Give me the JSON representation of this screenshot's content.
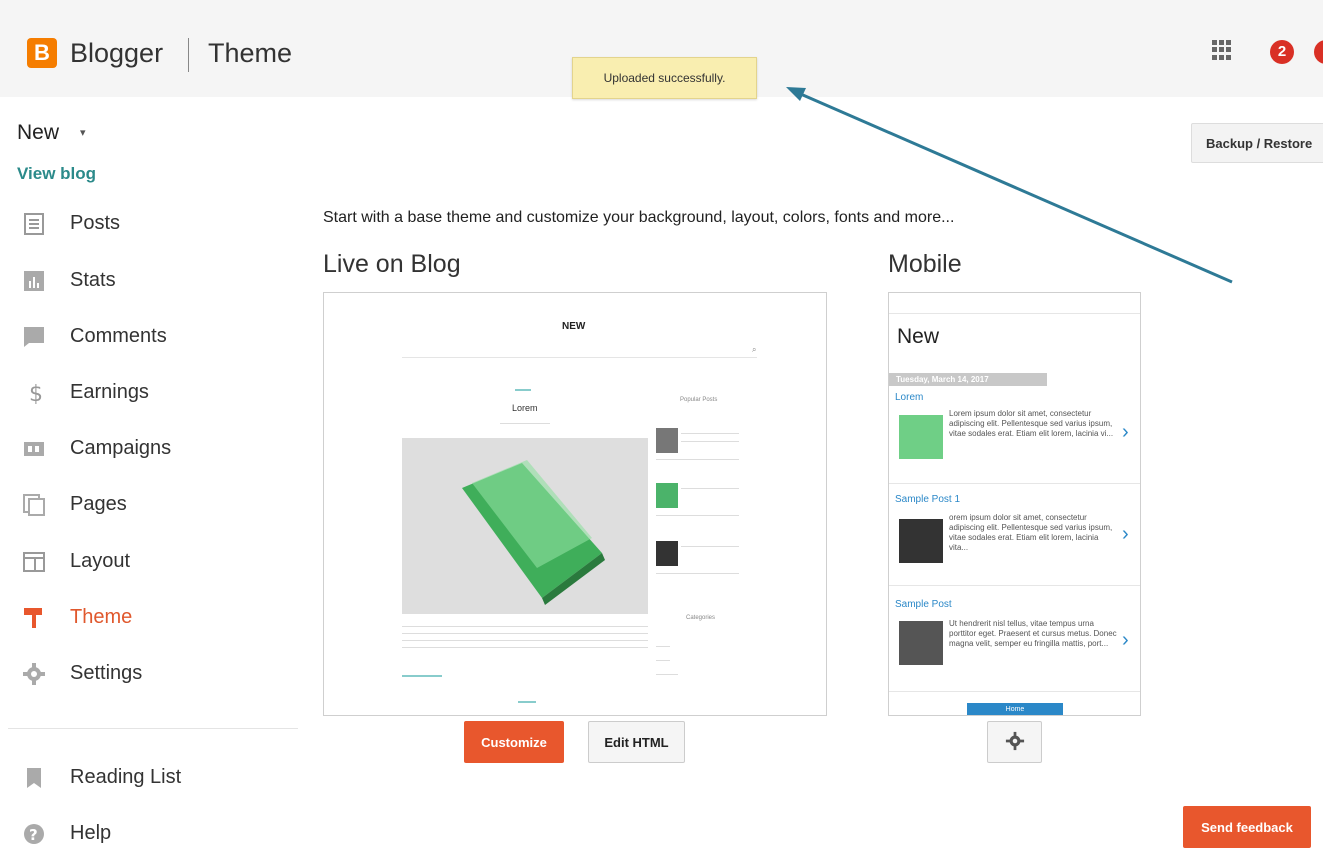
{
  "header": {
    "logo_letter": "B",
    "brand": "Blogger",
    "section": "Theme",
    "notification_count": "2",
    "icons": [
      "apps-grid-icon",
      "notifications-icon",
      "account-avatar-icon"
    ]
  },
  "toast": {
    "message": "Uploaded successfully."
  },
  "sidebar": {
    "blog_name": "New",
    "view_blog": "View blog",
    "items": [
      {
        "label": "Posts",
        "icon": "posts-icon"
      },
      {
        "label": "Stats",
        "icon": "stats-icon"
      },
      {
        "label": "Comments",
        "icon": "comments-icon"
      },
      {
        "label": "Earnings",
        "icon": "earnings-icon"
      },
      {
        "label": "Campaigns",
        "icon": "campaigns-icon"
      },
      {
        "label": "Pages",
        "icon": "pages-icon"
      },
      {
        "label": "Layout",
        "icon": "layout-icon"
      },
      {
        "label": "Theme",
        "icon": "theme-icon",
        "active": true
      },
      {
        "label": "Settings",
        "icon": "settings-icon"
      }
    ],
    "secondary": [
      {
        "label": "Reading List",
        "icon": "bookmark-icon"
      },
      {
        "label": "Help",
        "icon": "help-icon"
      }
    ]
  },
  "main": {
    "intro": "Start with a base theme and customize your background, layout, colors, fonts and more...",
    "live_heading": "Live on Blog",
    "mobile_heading": "Mobile",
    "backup_button": "Backup / Restore",
    "customize_button": "Customize",
    "edit_html_button": "Edit HTML",
    "feedback_button": "Send feedback"
  },
  "live_preview": {
    "blog_title": "NEW",
    "post_title": "Lorem",
    "sidebar_heading": "Popular Posts",
    "categories_heading": "Categories"
  },
  "mobile_preview": {
    "blog_title": "New",
    "date": "Tuesday, March 14, 2017",
    "posts": [
      {
        "title": "Lorem",
        "excerpt": "Lorem ipsum dolor sit amet, consectetur adipiscing elit. Pellentesque sed varius ipsum, vitae sodales erat. Etiam elit lorem, lacinia vi..."
      },
      {
        "title": "Sample Post 1",
        "excerpt": "orem ipsum dolor sit amet, consectetur adipiscing elit. Pellentesque sed varius ipsum, vitae sodales erat. Etiam elit lorem, lacinia vita..."
      },
      {
        "title": "Sample Post",
        "excerpt": "Ut hendrerit nisl tellus, vitae tempus urna porttitor eget. Praesent et cursus metus. Donec magna velit, semper eu fringilla mattis, port..."
      }
    ],
    "home_button": "Home"
  },
  "colors": {
    "accent": "#e8572d",
    "brand_orange": "#f57d00",
    "link_teal": "#2b8a8a",
    "annotation_arrow": "#2e7a96"
  }
}
